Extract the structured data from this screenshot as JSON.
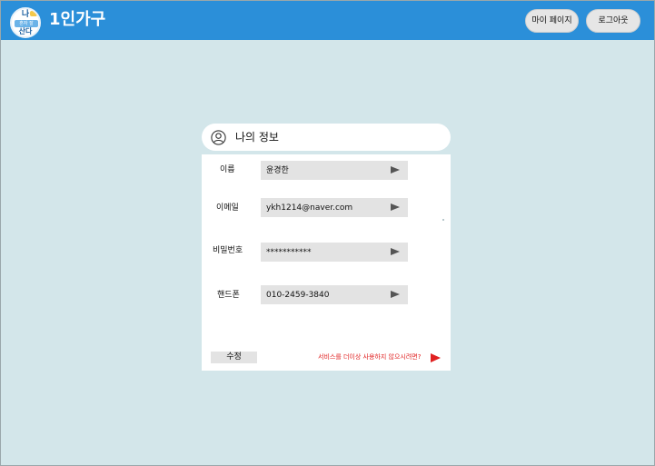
{
  "header": {
    "logo": {
      "top_text": "나",
      "mid_text": "혼자 잘",
      "bottom_text": "산다"
    },
    "title": "1인가구",
    "mypage_label": "마이 페이지",
    "logout_label": "로그아웃",
    "bar_color": "#2b8fd9"
  },
  "profile": {
    "title": "나의 정보",
    "icon": "user-circle-icon",
    "fields": [
      {
        "label": "이름",
        "value": "윤경한"
      },
      {
        "label": "이메일",
        "value": "ykh1214@naver.com"
      },
      {
        "label": "비밀번호",
        "value": "***********"
      },
      {
        "label": "핸드폰",
        "value": "010-2459-3840"
      }
    ],
    "field_arrow_icon": "play-arrow-icon",
    "edit_label": "수정",
    "withdraw_label": "서비스를 더이상 사용하지 않으시려면?",
    "withdraw_color": "#e02020"
  }
}
